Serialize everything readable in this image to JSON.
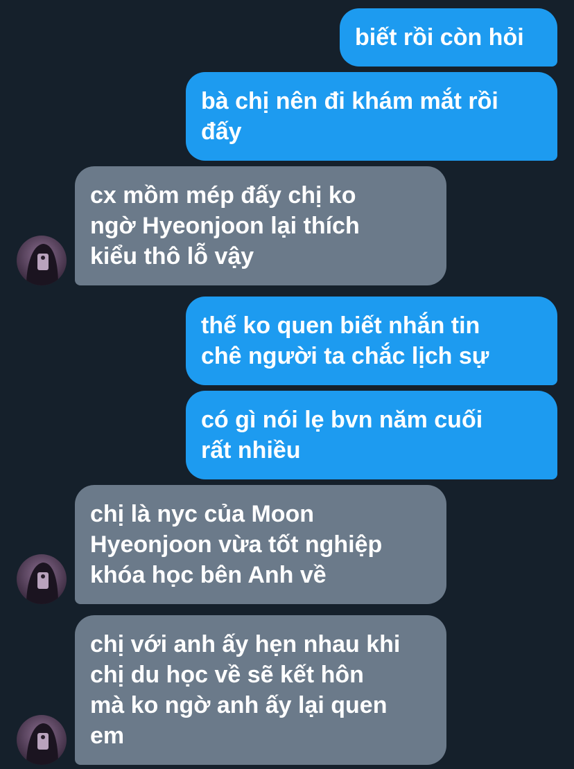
{
  "messages": [
    {
      "side": "sent",
      "text": "biết rồi còn hỏi"
    },
    {
      "side": "sent",
      "text": "bà chị nên đi khám mắt rồi\nđấy"
    },
    {
      "side": "received",
      "text": "cx mồm mép đấy chị ko\nngờ Hyeonjoon lại thích\nkiểu thô lỗ vậy",
      "avatar": "user-avatar"
    },
    {
      "side": "sent",
      "text": "thế ko quen biết nhắn tin\nchê người ta chắc lịch sự"
    },
    {
      "side": "sent",
      "text": "có gì nói lẹ bvn năm cuối\nrất nhiều"
    },
    {
      "side": "received",
      "text": "chị là nyc của Moon\nHyeonjoon vừa tốt nghiệp\nkhóa học bên Anh về",
      "avatar": "user-avatar"
    },
    {
      "side": "received",
      "text": "chị với anh ấy hẹn nhau khi\nchị du học về sẽ kết hôn\nmà ko ngờ anh ấy lại quen\nem",
      "avatar": "user-avatar"
    }
  ],
  "colors": {
    "background": "#15202b",
    "sent_bubble": "#1d9bf0",
    "received_bubble": "#6b7a8a",
    "text": "#ffffff"
  }
}
